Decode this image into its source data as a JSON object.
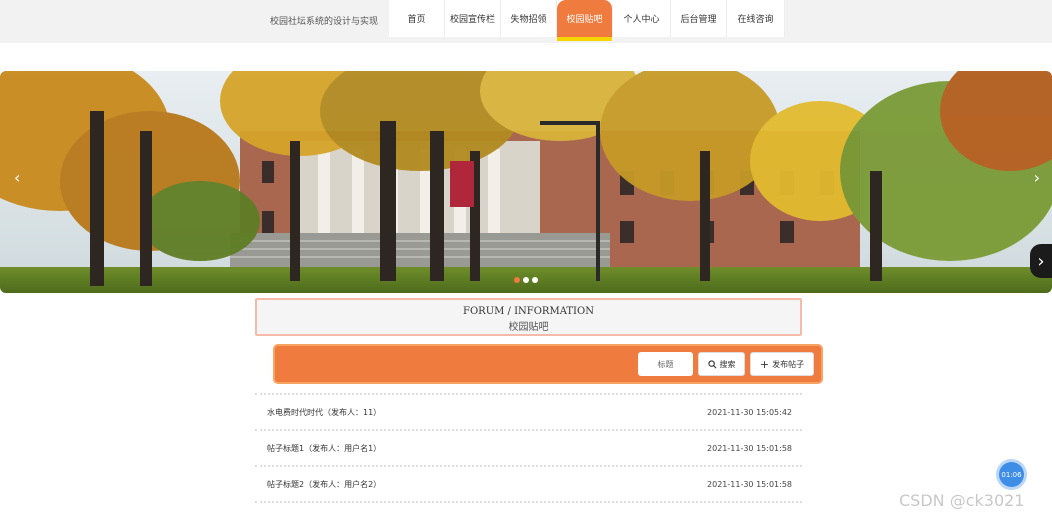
{
  "header": {
    "site_title": "校园社坛系统的设计与实现",
    "nav": [
      {
        "label": "首页"
      },
      {
        "label": "校园宣传栏"
      },
      {
        "label": "失物招领"
      },
      {
        "label": "校园贴吧",
        "active": true
      },
      {
        "label": "个人中心"
      },
      {
        "label": "后台管理"
      },
      {
        "label": "在线咨询"
      }
    ]
  },
  "banner": {
    "prev_icon": "chevron-left",
    "next_icon": "chevron-right",
    "slide_count": 3,
    "active_slide": 1
  },
  "section": {
    "title_en": "FORUM / INFORMATION",
    "title_cn": "校园贴吧"
  },
  "search": {
    "field_label": "标题",
    "search_button": "搜索",
    "publish_button": "发布帖子",
    "accent": "#f07b3f"
  },
  "posts": [
    {
      "title": "水电费时代时代（发布人：11）",
      "time": "2021-11-30 15:05:42"
    },
    {
      "title": "帖子标题1（发布人：用户名1）",
      "time": "2021-11-30 15:01:58"
    },
    {
      "title": "帖子标题2（发布人：用户名2）",
      "time": "2021-11-30 15:01:58"
    }
  ],
  "floating": {
    "clock": "01:06",
    "watermark": "CSDN @ck3021"
  }
}
